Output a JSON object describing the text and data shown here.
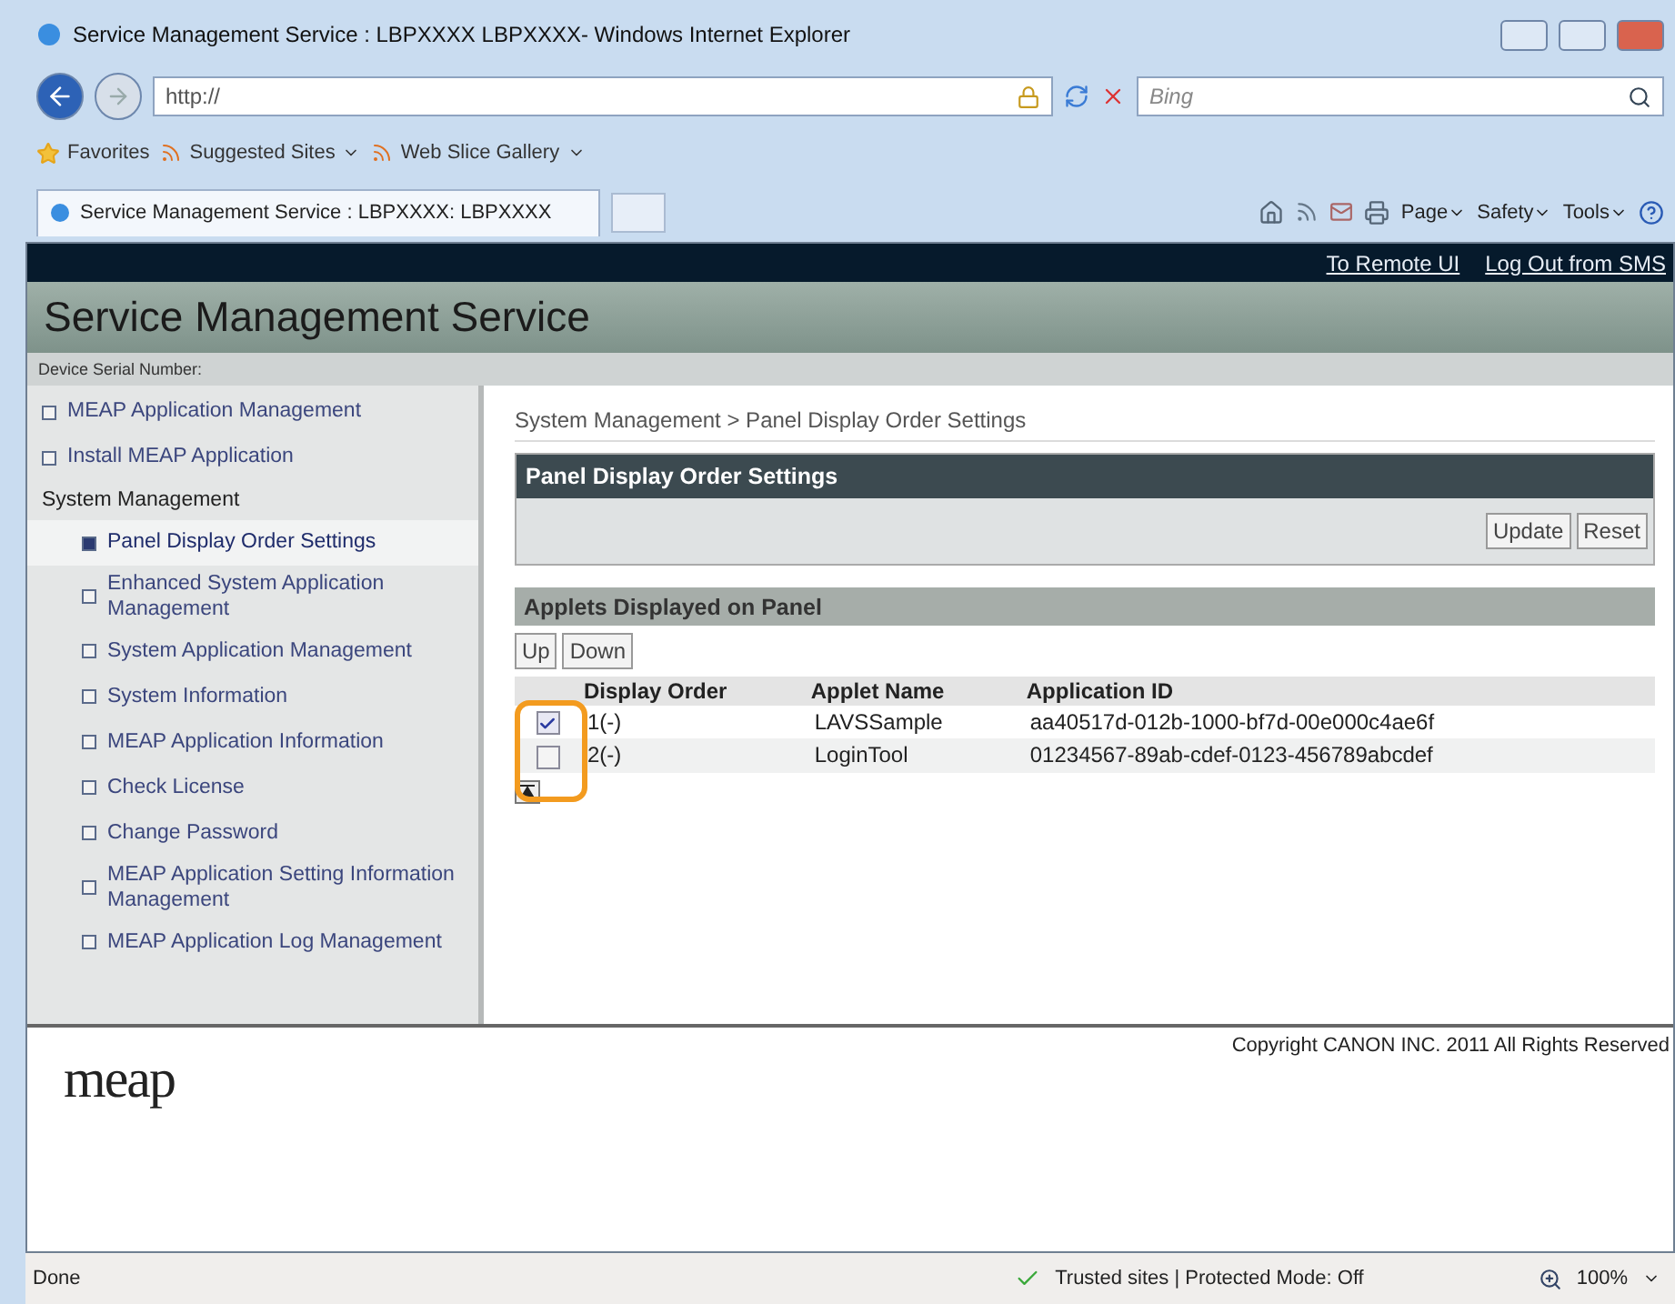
{
  "window": {
    "title": "Service Management Service : LBPXXXX  LBPXXXX- Windows Internet Explorer"
  },
  "address_bar": {
    "value": "http://",
    "search_placeholder": "Bing"
  },
  "favorites_bar": {
    "items": [
      {
        "label": "Favorites",
        "kind": "favorites"
      },
      {
        "label": "Suggested Sites",
        "kind": "menu"
      },
      {
        "label": "Web Slice Gallery",
        "kind": "menu"
      }
    ]
  },
  "tab": {
    "title": "Service Management Service : LBPXXXX: LBPXXXX"
  },
  "command_bar": {
    "items": [
      "Page",
      "Safety",
      "Tools"
    ]
  },
  "page": {
    "top_links": [
      "To Remote UI",
      "Log Out from SMS"
    ],
    "title": "Service Management Service",
    "serial_label": "Device Serial Number:",
    "sidebar": [
      {
        "label": "MEAP Application Management",
        "kind": "link",
        "selected": false
      },
      {
        "label": "Install MEAP Application",
        "kind": "link",
        "selected": false
      },
      {
        "label": "System Management",
        "kind": "group",
        "children": [
          {
            "label": "Panel Display Order Settings",
            "kind": "link",
            "selected": true
          },
          {
            "label": "Enhanced System Application Management",
            "kind": "link",
            "selected": false
          },
          {
            "label": "System Application Management",
            "kind": "link",
            "selected": false
          },
          {
            "label": "System Information",
            "kind": "link",
            "selected": false
          },
          {
            "label": "MEAP Application Information",
            "kind": "link",
            "selected": false
          },
          {
            "label": "Check License",
            "kind": "link",
            "selected": false
          },
          {
            "label": "Change Password",
            "kind": "link",
            "selected": false
          },
          {
            "label": "MEAP Application Setting Information Management",
            "kind": "link",
            "selected": false
          },
          {
            "label": "MEAP Application Log Management",
            "kind": "link",
            "selected": false
          }
        ]
      }
    ],
    "breadcrumb": "System Management > Panel Display Order Settings",
    "settings_section": {
      "title": "Panel Display Order Settings",
      "buttons": [
        "Update",
        "Reset"
      ]
    },
    "applets_section": {
      "title": "Applets Displayed on Panel",
      "buttons": [
        "Up",
        "Down"
      ],
      "columns": [
        "Display Order",
        "Applet Name",
        "Application ID"
      ],
      "rows": [
        {
          "checked": true,
          "order": "1(-)",
          "name": "LAVSSample",
          "id": "aa40517d-012b-1000-bf7d-00e000c4ae6f"
        },
        {
          "checked": false,
          "order": "2(-)",
          "name": "LoginTool",
          "id": "01234567-89ab-cdef-0123-456789abcdef"
        }
      ],
      "highlight_checkboxes": true
    },
    "logo": "meap",
    "copyright": "Copyright CANON INC. 2011 All Rights Reserved"
  },
  "status_bar": {
    "text": "Done",
    "zone": "Trusted sites | Protected Mode: Off",
    "zoom": "100%"
  }
}
